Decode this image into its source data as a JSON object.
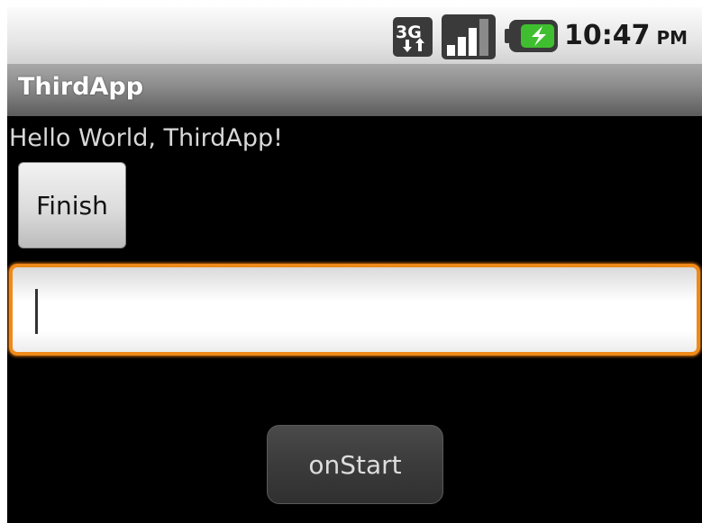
{
  "status_bar": {
    "network_label": "3G",
    "time": "10:47",
    "ampm": "PM",
    "icons": [
      "network-3g-icon",
      "signal-strength-icon",
      "battery-charging-icon"
    ],
    "battery_color": "#3fbf2f"
  },
  "title_bar": {
    "app_title": "ThirdApp"
  },
  "main": {
    "hello_text": "Hello World, ThirdApp!",
    "finish_button_label": "Finish",
    "text_field_value": "",
    "onstart_button_label": "onStart",
    "focus_color": "#ef8a1a"
  }
}
